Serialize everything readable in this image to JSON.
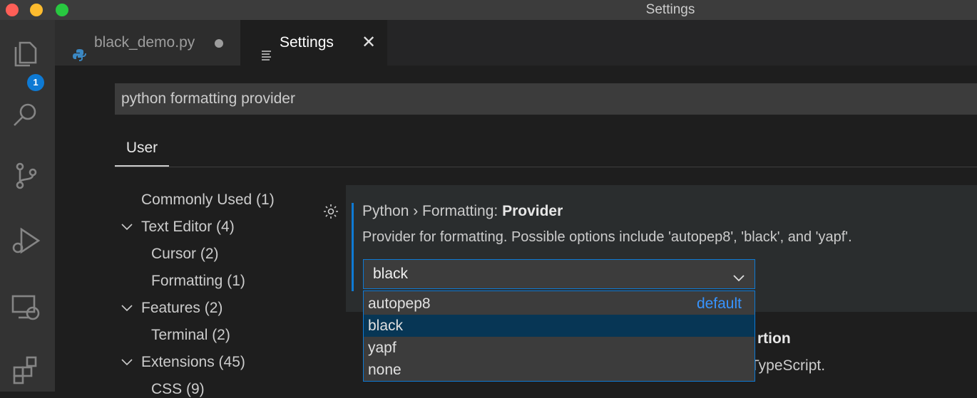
{
  "window": {
    "title": "Settings"
  },
  "activity_bar": {
    "items": [
      "explorer-icon",
      "search-icon",
      "source-control-icon",
      "run-debug-icon",
      "remote-explorer-icon",
      "extensions-icon"
    ],
    "explorer_badge": "1"
  },
  "tabs": [
    {
      "label": "black_demo.py",
      "icon": "python-icon",
      "dirty": true,
      "active": false
    },
    {
      "label": "Settings",
      "icon": "settings-editor-icon",
      "active": true
    }
  ],
  "search": {
    "value": "python formatting provider"
  },
  "scope_tabs": [
    {
      "label": "User",
      "active": true
    }
  ],
  "toc": [
    {
      "label": "Commonly Used (1)",
      "level": 0,
      "expandable": false
    },
    {
      "label": "Text Editor (4)",
      "level": 0,
      "expandable": true
    },
    {
      "label": "Cursor (2)",
      "level": 1,
      "expandable": false
    },
    {
      "label": "Formatting (1)",
      "level": 1,
      "expandable": false
    },
    {
      "label": "Features (2)",
      "level": 0,
      "expandable": true
    },
    {
      "label": "Terminal (2)",
      "level": 1,
      "expandable": false
    },
    {
      "label": "Extensions (45)",
      "level": 0,
      "expandable": true
    },
    {
      "label": "CSS (9)",
      "level": 1,
      "expandable": false
    }
  ],
  "setting": {
    "category": "Python › Formatting: ",
    "name": "Provider",
    "description": "Provider for formatting. Possible options include 'autopep8', 'black', and 'yapf'.",
    "value": "black",
    "options": [
      {
        "label": "autopep8",
        "tag": "default",
        "highlighted": false
      },
      {
        "label": "black",
        "tag": "",
        "highlighted": true
      },
      {
        "label": "yapf",
        "tag": "",
        "highlighted": false
      },
      {
        "label": "none",
        "tag": "",
        "highlighted": false
      }
    ]
  },
  "partial_next_setting": {
    "title_fragment": "rtion",
    "desc_fragment": "TypeScript."
  },
  "colors": {
    "accent": "#0e7ad4",
    "selected_option": "#073655",
    "default_tag": "#3794ff"
  }
}
